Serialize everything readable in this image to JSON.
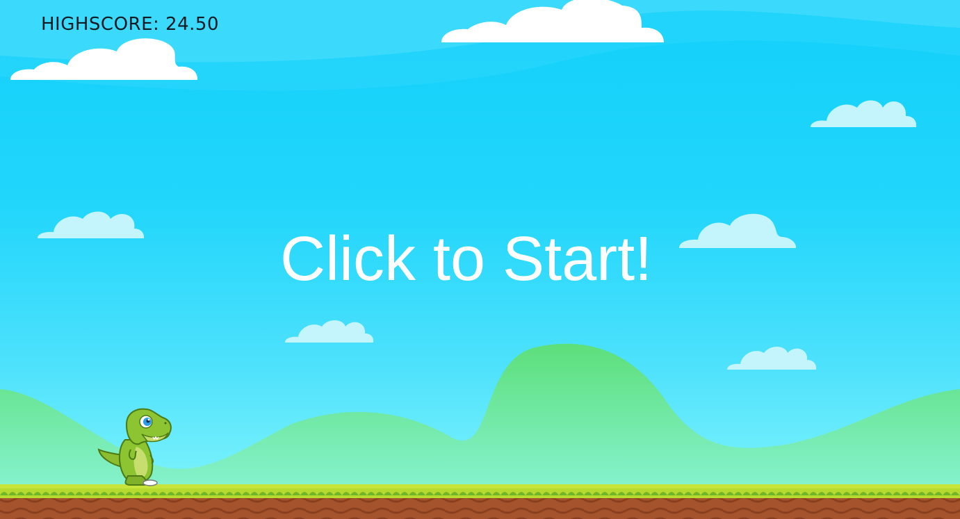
{
  "hud": {
    "highscore_label": "HIGHSCORE: 24.50",
    "start_prompt": "Click to Start!"
  },
  "colors": {
    "sky_top": "#12d0fb",
    "sky_bottom": "#78f1fc",
    "hills": "#5fe07e",
    "grass": "#b6db2e",
    "dirt": "#a0522d"
  },
  "icons": {
    "player": "dinosaur-icon",
    "cloud": "cloud-icon"
  }
}
